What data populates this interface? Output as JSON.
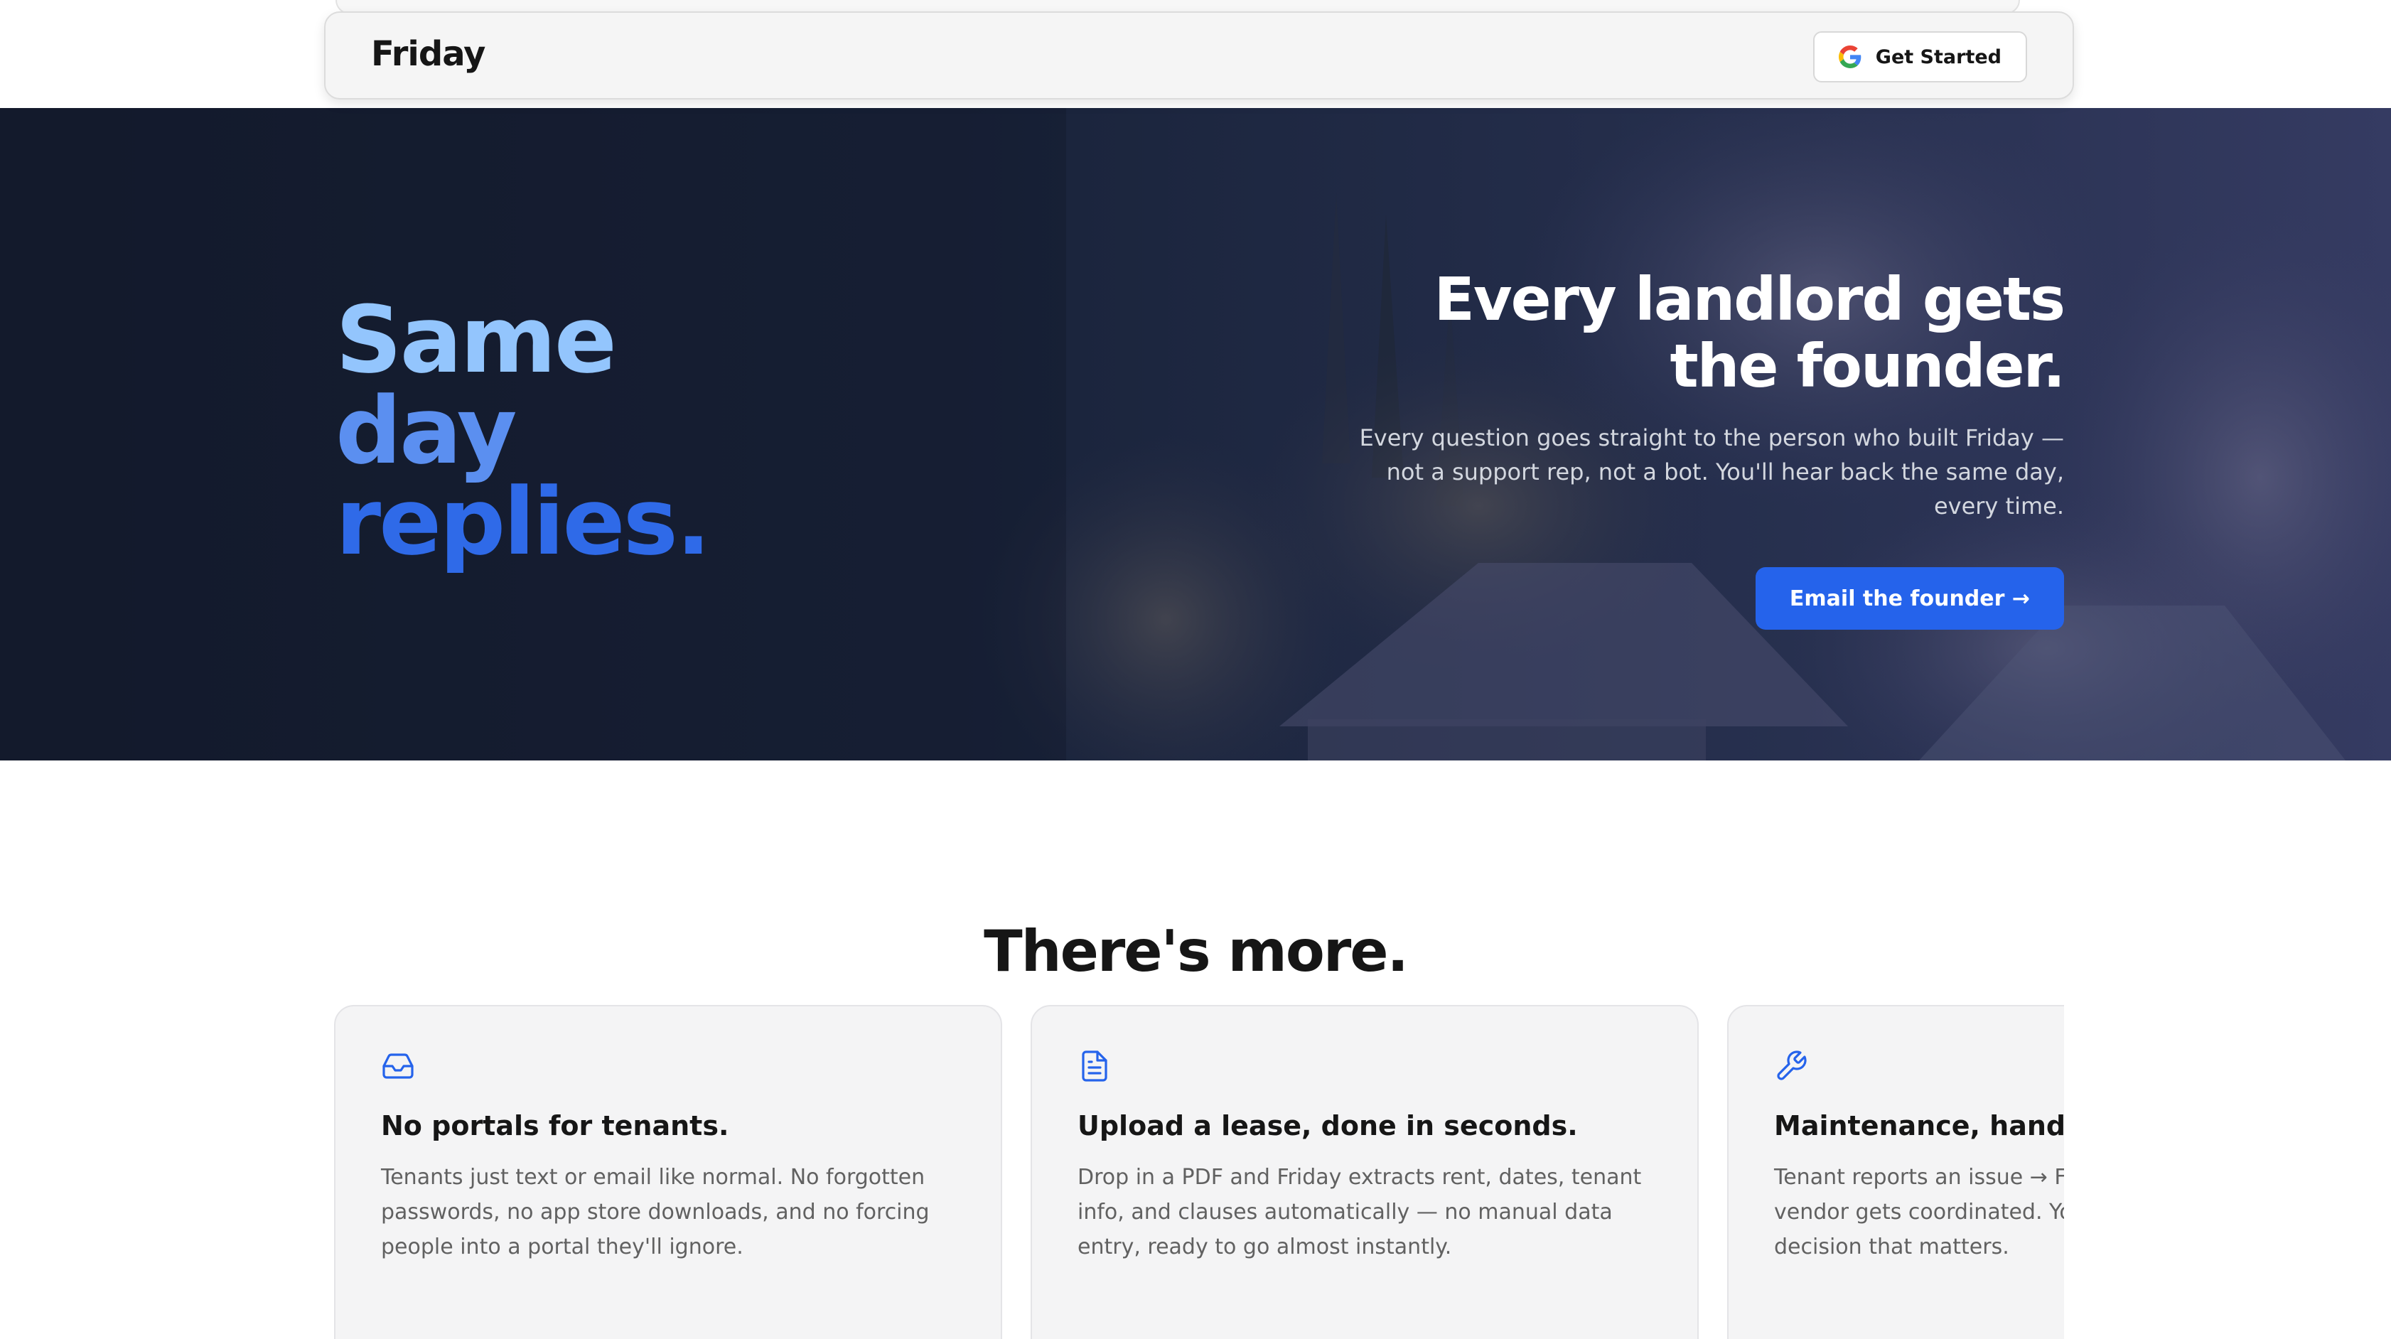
{
  "nav": {
    "brand": "Friday",
    "cta_label": "Get Started",
    "cta_icon": "google-g-icon"
  },
  "hero": {
    "tagline_lines": [
      "Same",
      "day",
      "replies."
    ],
    "tagline_colors": [
      "#93c5fd",
      "#5b8ff0",
      "#2f6ae8"
    ],
    "headline_line1": "Every landlord gets",
    "headline_line2": "the founder.",
    "subtext": "Every question goes straight to the person who built Friday — not a support rep, not a bot. You'll hear back the same day, every time.",
    "button_label": "Email the founder →"
  },
  "more": {
    "title": "There's more.",
    "cards": [
      {
        "icon": "inbox-icon",
        "title": "No portals for tenants.",
        "description": "Tenants just text or email like normal. No forgotten passwords, no app store downloads, and no forcing people into a portal they'll ignore."
      },
      {
        "icon": "document-icon",
        "title": "Upload a lease, done in seconds.",
        "description": "Drop in a PDF and Friday extracts rent, dates, tenant info, and clauses automatically — no manual data entry, ready to go almost instantly."
      },
      {
        "icon": "wrench-icon",
        "title": "Maintenance, handled.",
        "description": "Tenant reports an issue → Friday triages it → the vendor gets coordinated. You only step in for the one decision that matters."
      }
    ]
  },
  "colors": {
    "accent": "#2563eb",
    "hero_bg": "#172033",
    "card_bg": "#f4f4f5"
  }
}
